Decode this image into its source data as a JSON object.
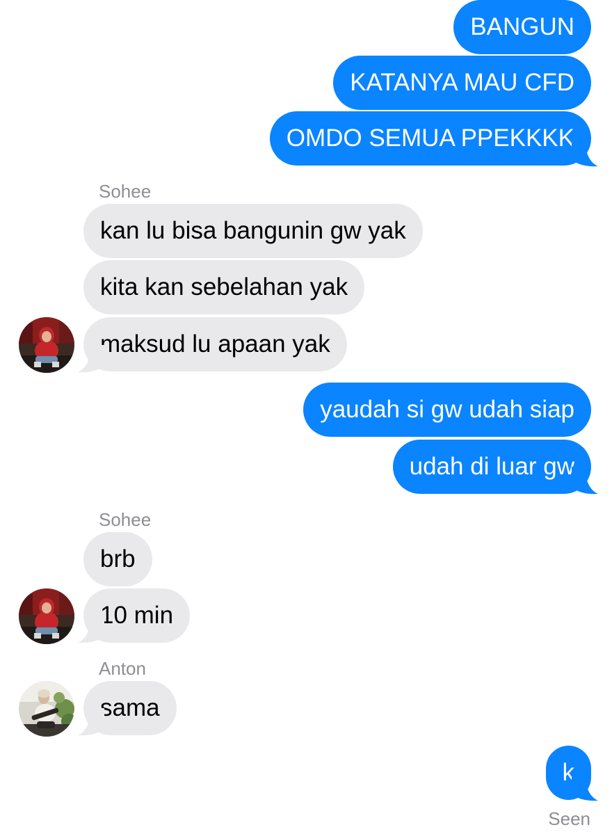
{
  "colors": {
    "sent_bubble": "#0a84ff",
    "received_bubble": "#e9e9eb",
    "meta_text": "#8e8e93"
  },
  "messages": [
    {
      "from": "me",
      "text": "BANGUN"
    },
    {
      "from": "me",
      "text": "KATANYA MAU CFD"
    },
    {
      "from": "me",
      "text": "OMDO SEMUA PPEKKKK"
    },
    {
      "from": "Sohee",
      "text": "kan lu bisa bangunin gw yak"
    },
    {
      "from": "Sohee",
      "text": "kita kan sebelahan yak"
    },
    {
      "from": "Sohee",
      "text": "maksud lu apaan yak"
    },
    {
      "from": "me",
      "text": "yaudah si gw udah siap"
    },
    {
      "from": "me",
      "text": "udah di luar gw"
    },
    {
      "from": "Sohee",
      "text": "brb"
    },
    {
      "from": "Sohee",
      "text": "10 min"
    },
    {
      "from": "Anton",
      "text": "sama"
    },
    {
      "from": "me",
      "text": "k"
    }
  ],
  "sender_labels": [
    "Sohee",
    "Sohee",
    "Anton"
  ],
  "avatars": [
    {
      "icon": "person-red-hoodie-avatar"
    },
    {
      "icon": "person-red-hoodie-avatar"
    },
    {
      "icon": "person-guitar-avatar"
    }
  ],
  "status": "Seen"
}
